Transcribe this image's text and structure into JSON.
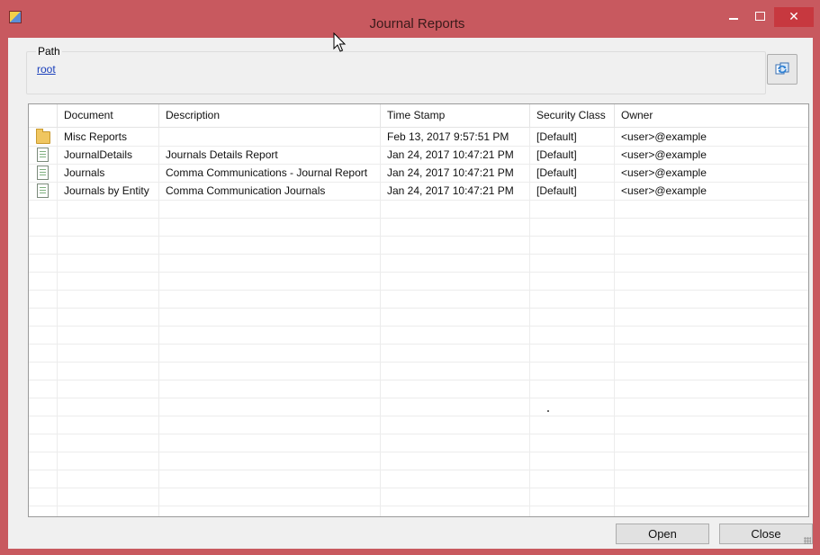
{
  "window": {
    "title": "Journal Reports",
    "close_glyph": "✕",
    "icons": [
      "app-icon",
      "minimize-icon",
      "maximize-icon",
      "close-icon"
    ]
  },
  "path": {
    "label": "Path",
    "link": "root",
    "refresh_icon": "refresh-icon"
  },
  "table": {
    "columns": [
      "Document",
      "Description",
      "Time Stamp",
      "Security Class",
      "Owner"
    ],
    "rows": [
      {
        "icon": "folder-icon",
        "document": "Misc Reports",
        "description": "",
        "timestamp": "Feb 13, 2017 9:57:51 PM",
        "security": "[Default]",
        "owner": "<user>@example"
      },
      {
        "icon": "document-icon",
        "document": "JournalDetails",
        "description": "Journals Details Report",
        "timestamp": "Jan 24, 2017 10:47:21 PM",
        "security": "[Default]",
        "owner": "<user>@example"
      },
      {
        "icon": "document-icon",
        "document": "Journals",
        "description": "Comma Communications - Journal Report",
        "timestamp": "Jan 24, 2017 10:47:21 PM",
        "security": "[Default]",
        "owner": "<user>@example"
      },
      {
        "icon": "document-icon",
        "document": "Journals by Entity",
        "description": "Comma Communication Journals",
        "timestamp": "Jan 24, 2017 10:47:21 PM",
        "security": "[Default]",
        "owner": "<user>@example"
      }
    ]
  },
  "buttons": {
    "open": "Open",
    "close": "Close"
  },
  "colors": {
    "titlebar": "#c8595f",
    "close_button": "#c7383f",
    "link": "#1a3fbb",
    "client_background": "#f0f0f0"
  }
}
